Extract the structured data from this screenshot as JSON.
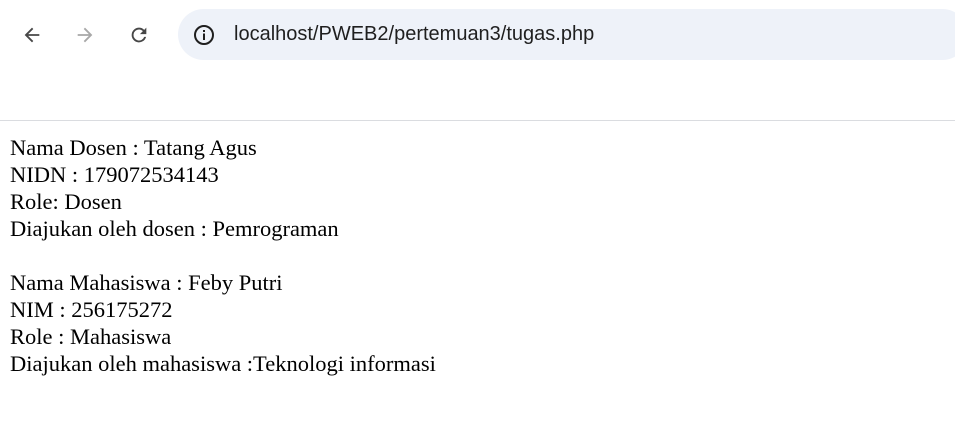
{
  "browser": {
    "back_icon": "arrow-left-icon",
    "forward_icon": "arrow-right-icon",
    "reload_icon": "reload-icon",
    "site_info_icon": "info-circle-icon",
    "url": "localhost/PWEB2/pertemuan3/tugas.php"
  },
  "page": {
    "dosen": {
      "nama": "Nama Dosen : Tatang Agus",
      "nidn": "NIDN : 179072534143",
      "role": "Role: Dosen",
      "diajukan": "Diajukan oleh dosen : Pemrograman"
    },
    "mahasiswa": {
      "nama": "Nama Mahasiswa : Feby Putri",
      "nim": "NIM : 256175272",
      "role": "Role : Mahasiswa",
      "diajukan": "Diajukan oleh mahasiswa :Teknologi informasi"
    }
  }
}
